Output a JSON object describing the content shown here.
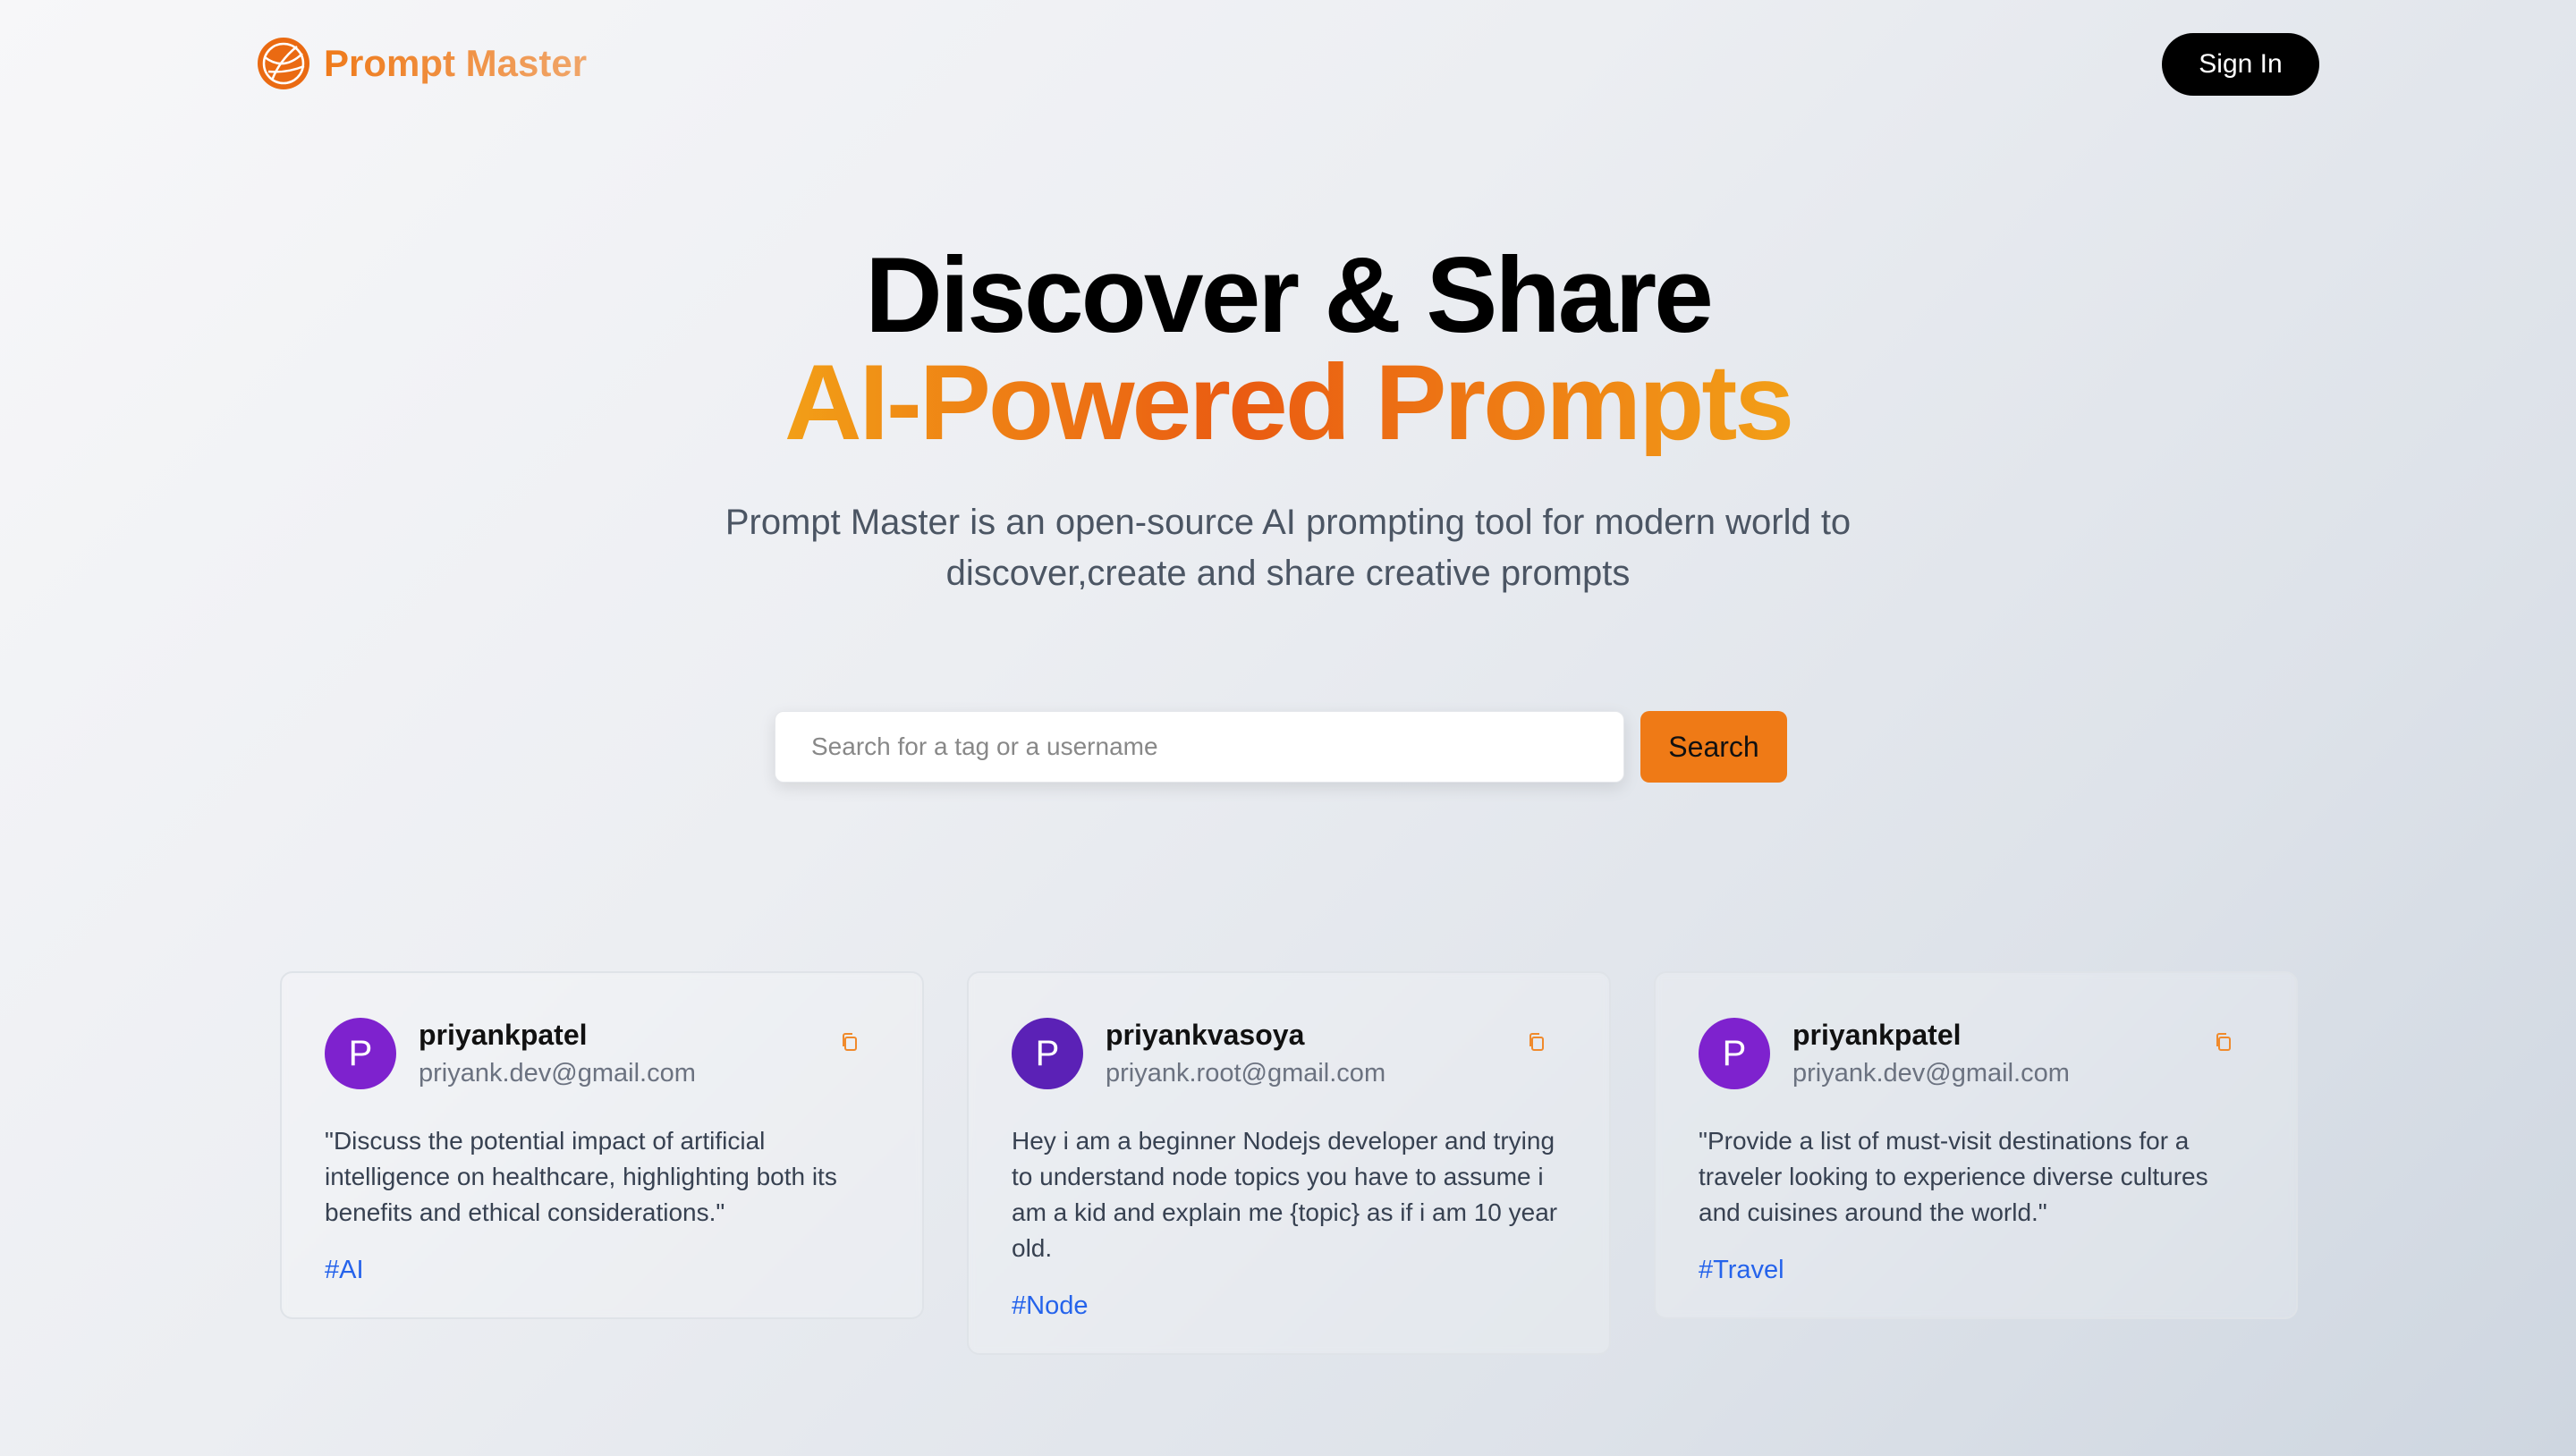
{
  "header": {
    "logo_text": "Prompt Master",
    "signin_label": "Sign In"
  },
  "hero": {
    "title_line1": "Discover & Share",
    "title_line2": "AI-Powered Prompts",
    "description": "Prompt Master is an open-source AI prompting tool for modern world to discover,create and share creative prompts"
  },
  "search": {
    "placeholder": "Search for a tag or a username",
    "value": "",
    "button_label": "Search"
  },
  "cards": [
    {
      "avatar_letter": "P",
      "avatar_color": "#7e22ce",
      "username": "priyankpatel",
      "email": "priyank.dev@gmail.com",
      "prompt": "\"Discuss the potential impact of artificial intelligence on healthcare, highlighting both its benefits and ethical considerations.\"",
      "tag": "#AI",
      "icon": "copy-icon"
    },
    {
      "avatar_letter": "P",
      "avatar_color": "#5b21b6",
      "username": "priyankvasoya",
      "email": "priyank.root@gmail.com",
      "prompt": "Hey i am a beginner Nodejs developer and trying to understand node topics you have to assume i am a kid and explain me {topic} as if i am 10 year old.",
      "tag": "#Node",
      "icon": "copy-icon"
    },
    {
      "avatar_letter": "P",
      "avatar_color": "#7e22ce",
      "username": "priyankpatel",
      "email": "priyank.dev@gmail.com",
      "prompt": "\"Provide a list of must-visit destinations for a traveler looking to experience diverse cultures and cuisines around the world.\"",
      "tag": "#Travel",
      "icon": "copy-icon"
    }
  ],
  "colors": {
    "brand_orange": "#ef7a16",
    "tag_blue": "#2563eb"
  }
}
